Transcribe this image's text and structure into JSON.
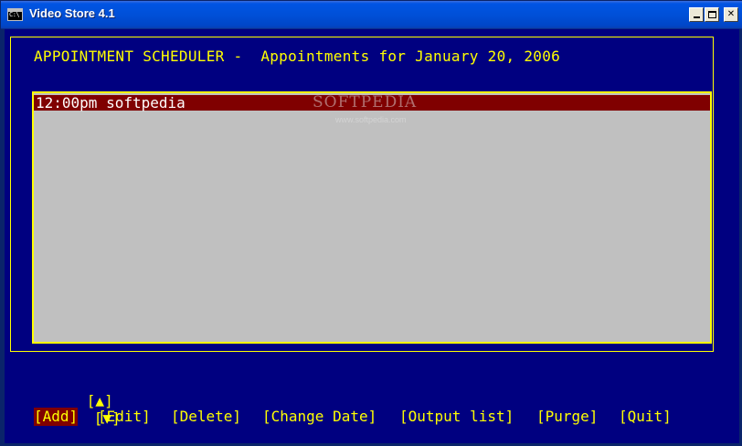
{
  "window": {
    "title": "Video Store 4.1",
    "icon_label": "C:\\"
  },
  "screen": {
    "header": "APPOINTMENT SCHEDULER -  Appointments for January 20, 2006",
    "appointments": [
      {
        "text": "12:00pm softpedia",
        "selected": true
      }
    ],
    "watermark": "SOFTPEDIA",
    "watermark_url": "www.softpedia.com",
    "scroll_up": "[▲]",
    "scroll_down": "[▼]",
    "menu": [
      {
        "label": "[Add]",
        "active": true
      },
      {
        "label": "[Edit]",
        "active": false
      },
      {
        "label": "[Delete]",
        "active": false
      },
      {
        "label": "[Change Date]",
        "active": false
      },
      {
        "label": "[Output list]",
        "active": false
      },
      {
        "label": "[Purge]",
        "active": false
      },
      {
        "label": "[Quit]",
        "active": false
      }
    ]
  },
  "colors": {
    "console_bg": "#000080",
    "text_yellow": "#ffff00",
    "selection_bg": "#800000",
    "list_bg": "#c0c0c0"
  }
}
